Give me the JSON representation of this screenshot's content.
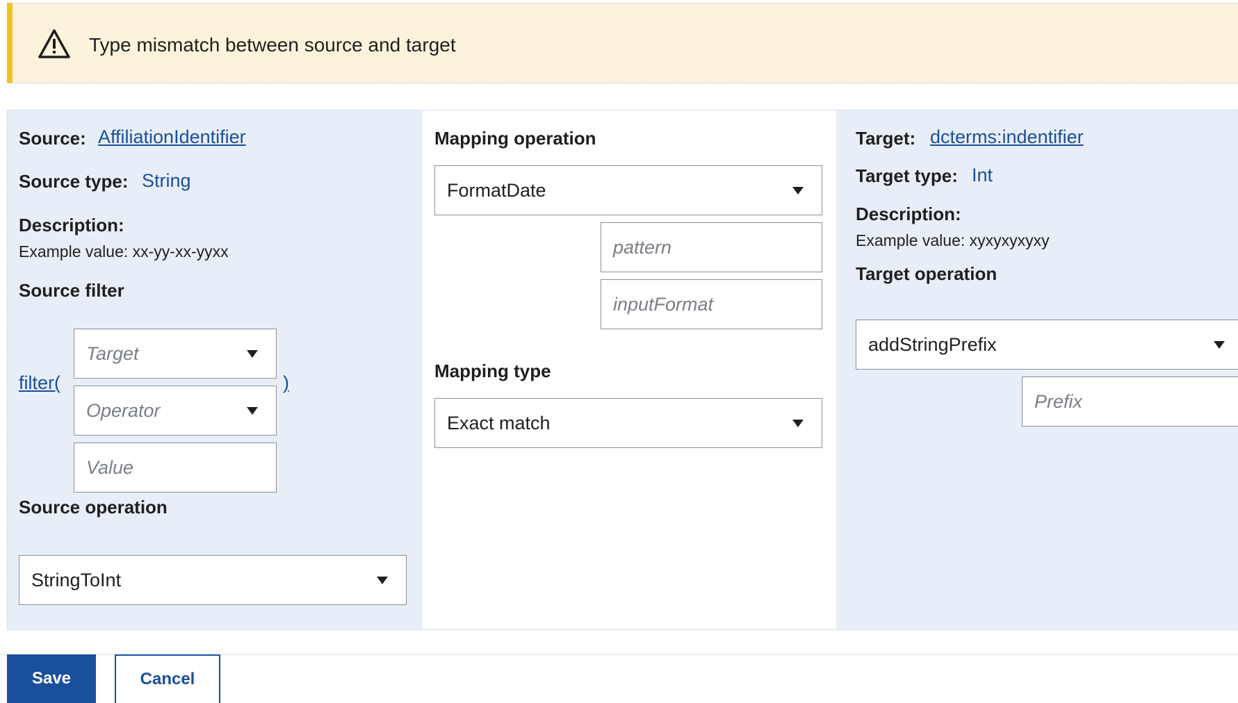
{
  "warning": {
    "icon": "warning-triangle-icon",
    "message": "Type mismatch between source and target"
  },
  "source": {
    "label": "Source:",
    "name": "AffiliationIdentifier",
    "type_label": "Source type:",
    "type_value": "String",
    "description_label": "Description:",
    "example": "Example value: xx-yy-xx-yyxx",
    "filter_label": "Source filter",
    "filter_open": "filter(",
    "filter_close": ")",
    "filter_target_placeholder": "Target",
    "filter_operator_placeholder": "Operator",
    "filter_value_placeholder": "Value",
    "operation_label": "Source operation",
    "operation_value": "StringToInt"
  },
  "mapping": {
    "operation_label": "Mapping operation",
    "operation_value": "FormatDate",
    "pattern_placeholder": "pattern",
    "input_format_placeholder": "inputFormat",
    "type_label": "Mapping type",
    "type_value": "Exact match"
  },
  "target": {
    "label": "Target:",
    "name": "dcterms:indentifier",
    "type_label": "Target type:",
    "type_value": "Int",
    "description_label": "Description:",
    "example": "Example value: xyxyxyxyxy",
    "operation_label": "Target operation",
    "operation_value": "addStringPrefix",
    "prefix_placeholder": "Prefix"
  },
  "actions": {
    "save": "Save",
    "cancel": "Cancel"
  },
  "colors": {
    "accent": "#1a4f9c",
    "warning_bg": "#fdf3dc",
    "warning_border": "#f1c21b",
    "panel_bg": "#e8eef8"
  }
}
